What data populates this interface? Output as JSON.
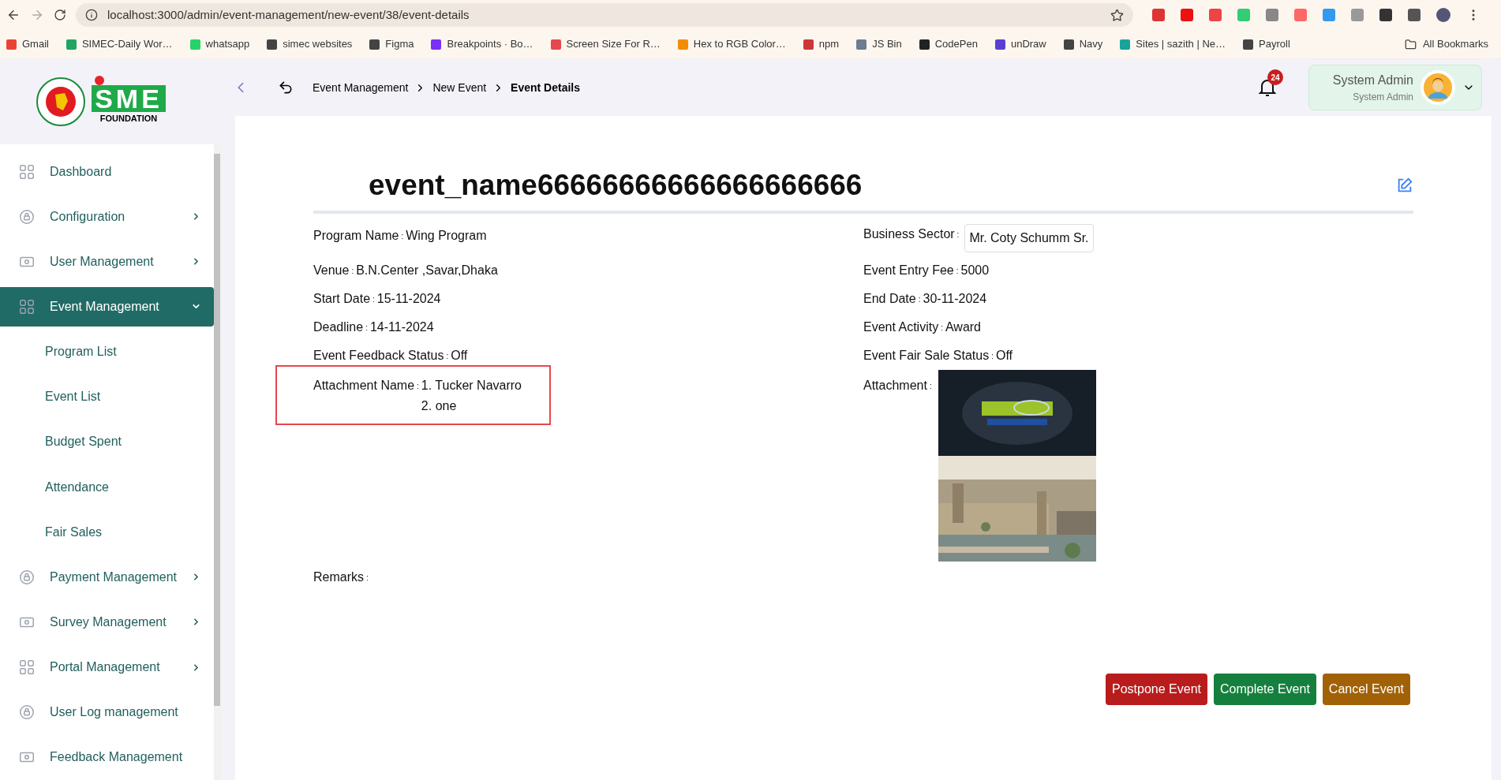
{
  "browser": {
    "url": "localhost:3000/admin/event-management/new-event/38/event-details",
    "bookmarks": [
      {
        "label": "Gmail",
        "color": "#ea4335"
      },
      {
        "label": "SIMEC-Daily Wor…",
        "color": "#1fa463"
      },
      {
        "label": "whatsapp",
        "color": "#25d366"
      },
      {
        "label": "simec websites",
        "color": "#444444"
      },
      {
        "label": "Figma",
        "color": "#444444"
      },
      {
        "label": "Breakpoints · Bo…",
        "color": "#7b2ff7"
      },
      {
        "label": "Screen Size For R…",
        "color": "#e5484d"
      },
      {
        "label": "Hex to RGB Color…",
        "color": "#f28c00"
      },
      {
        "label": "npm",
        "color": "#cb3837"
      },
      {
        "label": "JS Bin",
        "color": "#6b7c93"
      },
      {
        "label": "CodePen",
        "color": "#222222"
      },
      {
        "label": "unDraw",
        "color": "#5b3fd1"
      },
      {
        "label": "Navy",
        "color": "#444444"
      },
      {
        "label": "Sites | sazith | Ne…",
        "color": "#1aa39a"
      },
      {
        "label": "Payroll",
        "color": "#444444"
      }
    ],
    "all_bookmarks": "All Bookmarks"
  },
  "logo": {
    "letters": "SME",
    "tagline": "FOUNDATION"
  },
  "sidebar": {
    "items": [
      {
        "label": "Dashboard",
        "expandable": false,
        "selected": false
      },
      {
        "label": "Configuration",
        "expandable": true,
        "selected": false
      },
      {
        "label": "User Management",
        "expandable": true,
        "selected": false
      },
      {
        "label": "Event Management",
        "expandable": true,
        "selected": true,
        "children": [
          {
            "label": "Program List"
          },
          {
            "label": "Event List"
          },
          {
            "label": "Budget Spent"
          },
          {
            "label": "Attendance"
          },
          {
            "label": "Fair Sales"
          }
        ]
      },
      {
        "label": "Payment Management",
        "expandable": true,
        "selected": false
      },
      {
        "label": "Survey Management",
        "expandable": true,
        "selected": false
      },
      {
        "label": "Portal Management",
        "expandable": true,
        "selected": false
      },
      {
        "label": "User Log management",
        "expandable": false,
        "selected": false
      },
      {
        "label": "Feedback Management",
        "expandable": false,
        "selected": false
      }
    ]
  },
  "breadcrumb": [
    "Event Management",
    "New Event",
    "Event Details"
  ],
  "notifications": {
    "count": "24"
  },
  "user": {
    "name": "System Admin",
    "role": "System Admin"
  },
  "event": {
    "title": "event_name66666666666666666666",
    "left": [
      {
        "label": "Program Name",
        "sep": ":",
        "value": "Wing Program"
      },
      {
        "label": "Venue",
        "sep": ":",
        "value": "B.N.Center ,Savar,Dhaka"
      },
      {
        "label": "Start Date",
        "sep": ":",
        "value": "15-11-2024"
      },
      {
        "label": "Deadline",
        "sep": ":",
        "value": "14-11-2024"
      },
      {
        "label": "Event Feedback Status",
        "sep": ":",
        "value": "Off"
      }
    ],
    "right": [
      {
        "label": "Business Sector",
        "sep": ":",
        "value": "Mr. Coty Schumm Sr.",
        "boxed": true
      },
      {
        "label": "Event Entry Fee",
        "sep": ":",
        "value": "5000",
        "boxed": false
      },
      {
        "label": "End Date",
        "sep": ":",
        "value": "30-11-2024",
        "boxed": false
      },
      {
        "label": "Event Activity",
        "sep": ":",
        "value": "Award",
        "boxed": false
      },
      {
        "label": "Event Fair Sale Status",
        "sep": ":",
        "value": "Off",
        "boxed": false
      }
    ],
    "attachment_names_sep": ":",
    "attachment_sep": ":",
    "remarks_sep": ":",
    "attachment_names_label": "Attachment Name",
    "attachment_names": [
      "1. Tucker Navarro",
      "2. one"
    ],
    "attachment_label": "Attachment",
    "attachments": [
      {
        "kind": "picture"
      },
      {
        "kind": "picture"
      }
    ],
    "remarks_label": "Remarks"
  },
  "actions": [
    {
      "label": "Postpone Event",
      "color": "#b91c1c"
    },
    {
      "label": "Complete Event",
      "color": "#15803d"
    },
    {
      "label": "Cancel Event",
      "color": "#a16207"
    }
  ]
}
